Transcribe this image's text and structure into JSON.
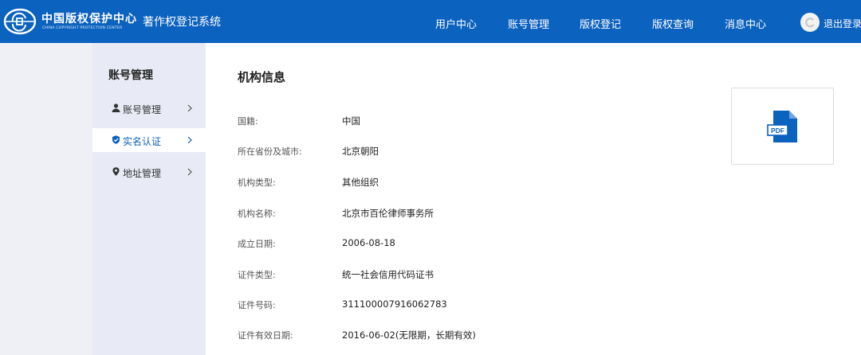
{
  "header": {
    "brand_cn": "中国版权保护中心",
    "brand_en": "CHINA COPYRIGHT PROTECTION CENTER",
    "system_title": "著作权登记系统",
    "nav": [
      "用户中心",
      "账号管理",
      "版权登记",
      "版权查询",
      "消息中心"
    ],
    "logout": "退出登录"
  },
  "sidebar": {
    "title": "账号管理",
    "items": [
      {
        "label": "账号管理",
        "icon": "user-icon"
      },
      {
        "label": "实名认证",
        "icon": "verified-badge-icon",
        "active": true
      },
      {
        "label": "地址管理",
        "icon": "location-pin-icon"
      }
    ]
  },
  "main": {
    "title": "机构信息",
    "fields": [
      {
        "label": "国籍:",
        "value": "中国"
      },
      {
        "label": "所在省份及城市:",
        "value": "北京朝阳"
      },
      {
        "label": "机构类型:",
        "value": "其他组织"
      },
      {
        "label": "机构名称:",
        "value": "北京市百伦律师事务所"
      },
      {
        "label": "成立日期:",
        "value": "2006-08-18"
      },
      {
        "label": "证件类型:",
        "value": "统一社会信用代码证书"
      },
      {
        "label": "证件号码:",
        "value": "311100007916062783"
      },
      {
        "label": "证件有效日期:",
        "value": "2016-06-02(无限期，长期有效)"
      }
    ],
    "attachment": {
      "icon": "pdf-file-icon",
      "badge": "PDF"
    }
  },
  "colors": {
    "header_bg": "#0c62bf",
    "accent": "#0c62bf",
    "sidebar_bg": "#e8ebf5",
    "page_bg": "#eef0f5"
  }
}
